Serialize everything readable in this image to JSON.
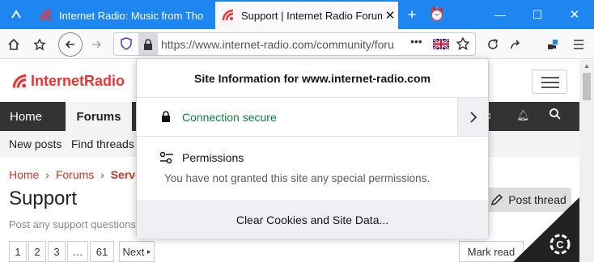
{
  "browser": {
    "tabs": [
      {
        "title": "Internet Radio: Music from Tho",
        "active": false
      },
      {
        "title": "Support | Internet Radio Forum",
        "active": true
      }
    ],
    "url": "https://www.internet-radio.com/community/foru",
    "colors": {
      "titlebar": "#1e86f0",
      "accent": "#e33333"
    }
  },
  "site": {
    "logo": "InternetRadio",
    "nav": {
      "home": "Home",
      "forums": "Forums"
    },
    "subnav": {
      "new_posts": "New posts",
      "find_threads": "Find threads"
    },
    "breadcrumb": [
      "Home",
      "Forums",
      "Serve"
    ],
    "page_title": "Support",
    "page_description": "Post any support questions",
    "post_thread": "Post thread",
    "pager": [
      "1",
      "2",
      "3",
      "…",
      "61"
    ],
    "next": "Next",
    "mark_read": "Mark read"
  },
  "popup": {
    "title": "Site Information for www.internet-radio.com",
    "connection": "Connection secure",
    "permissions_label": "Permissions",
    "permissions_desc": "You have not granted this site any special permissions.",
    "clear_cookies": "Clear Cookies and Site Data..."
  }
}
